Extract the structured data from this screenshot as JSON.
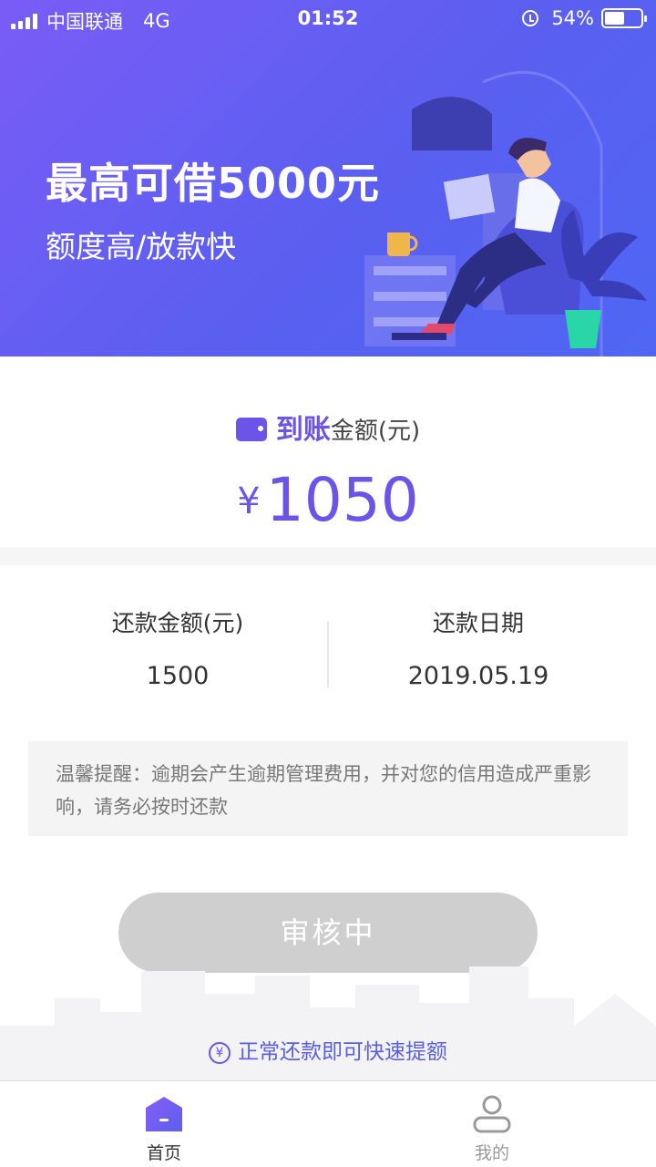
{
  "status_bar": {
    "carrier": "中国联通",
    "network": "4G",
    "time": "01:52",
    "battery": "54%",
    "battery_level": 0.54
  },
  "banner": {
    "title": "最高可借5000元",
    "subtitle": "额度高/放款快"
  },
  "arrival": {
    "highlight": "到账",
    "label": "金额(元)",
    "currency": "¥",
    "amount": "1050"
  },
  "repayment": {
    "amount_label": "还款金额(元)",
    "amount_value": "1500",
    "date_label": "还款日期",
    "date_value": "2019.05.19"
  },
  "notice": "温馨提醒：逾期会产生逾期管理费用，并对您的信用造成严重影响，请务必按时还款",
  "action_button": "审核中",
  "tip": "正常还款即可快速提额",
  "tip_icon": "¥",
  "tabbar": {
    "home": "首页",
    "mine": "我的"
  },
  "colors": {
    "accent": "#6d54e8",
    "banner_start": "#7a5cf6",
    "banner_end": "#4f66f4",
    "button_disabled": "#cfcfcf"
  },
  "icons": [
    "signal-icon",
    "alarm-icon",
    "battery-icon",
    "wallet-icon",
    "yen-coin-icon",
    "home-icon",
    "user-icon"
  ]
}
